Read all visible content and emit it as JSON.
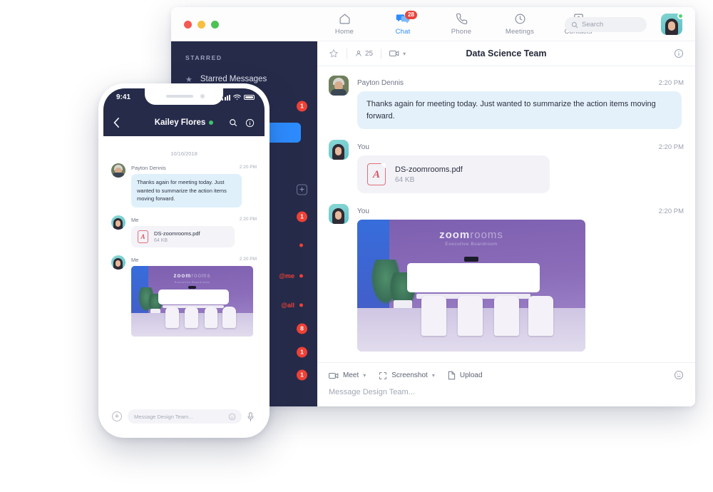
{
  "desktop": {
    "window_controls": [
      "close",
      "minimize",
      "maximize"
    ],
    "nav": [
      {
        "label": "Home",
        "icon": "home-icon",
        "active": false,
        "badge": ""
      },
      {
        "label": "Chat",
        "icon": "chat-icon",
        "active": true,
        "badge": "28"
      },
      {
        "label": "Phone",
        "icon": "phone-icon",
        "active": false,
        "badge": ""
      },
      {
        "label": "Meetings",
        "icon": "clock-icon",
        "active": false,
        "badge": ""
      },
      {
        "label": "Contacts",
        "icon": "contacts-icon",
        "active": false,
        "badge": ""
      }
    ],
    "search": {
      "placeholder": "Search",
      "icon": "search-icon"
    },
    "profile": {
      "name": "avatar",
      "presence": "available"
    },
    "sidebar": {
      "section_label": "STARRED",
      "items": [
        {
          "label": "Starred Messages",
          "icon": "star-icon",
          "badge": "",
          "dot": false,
          "mention": ""
        },
        {
          "label": "",
          "icon": "",
          "badge": "1",
          "dot": false,
          "mention": ""
        },
        {
          "label": "",
          "icon": "",
          "badge": "",
          "dot": false,
          "mention": "",
          "selected": true
        },
        {
          "label": "",
          "icon": "",
          "badge": "",
          "dot": false,
          "mention": ""
        },
        {
          "label": "",
          "icon": "",
          "badge": "",
          "dot": false,
          "mention": "",
          "plus": true
        },
        {
          "label": "",
          "icon": "",
          "badge": "1",
          "dot": false,
          "mention": ""
        },
        {
          "label": "",
          "icon": "",
          "badge": "",
          "dot": true,
          "mention": ""
        },
        {
          "label": "",
          "icon": "",
          "badge": "",
          "dot": true,
          "mention": "@me"
        },
        {
          "label": "",
          "icon": "",
          "badge": "",
          "dot": true,
          "mention": "@all"
        },
        {
          "label": "",
          "icon": "",
          "badge": "8",
          "dot": false,
          "mention": ""
        },
        {
          "label": "",
          "icon": "",
          "badge": "1",
          "dot": false,
          "mention": ""
        },
        {
          "label": "",
          "icon": "",
          "badge": "1",
          "dot": false,
          "mention": ""
        }
      ]
    },
    "chat_header": {
      "star_icon": "star-outline-icon",
      "members_count": "25",
      "members_icon": "person-icon",
      "camera_icon": "camera-icon",
      "title": "Data Science Team",
      "info_icon": "info-icon"
    },
    "messages": [
      {
        "sender": "Payton Dennis",
        "time": "2:20 PM",
        "type": "text",
        "text": "Thanks again for meeting today. Just wanted to summarize the action items moving forward.",
        "avatar": "payton"
      },
      {
        "sender": "You",
        "time": "2:20 PM",
        "type": "file",
        "file_name": "DS-zoomrooms.pdf",
        "file_size": "64 KB",
        "avatar": "me"
      },
      {
        "sender": "You",
        "time": "2:20 PM",
        "type": "image",
        "image_caption": "zoom",
        "image_caption_light": "rooms",
        "image_subtitle": "Executive Boardroom",
        "avatar": "me"
      }
    ],
    "composer": {
      "tools": [
        {
          "label": "Meet",
          "icon": "camera-icon",
          "has_caret": true
        },
        {
          "label": "Screenshot",
          "icon": "screenshot-icon",
          "has_caret": true
        },
        {
          "label": "Upload",
          "icon": "file-icon",
          "has_caret": false
        }
      ],
      "placeholder": "Message Design Team...",
      "emoji_icon": "emoji-icon"
    }
  },
  "phone": {
    "status_bar": {
      "time": "9:41",
      "signal_icon": "signal-icon",
      "wifi_icon": "wifi-icon",
      "battery_icon": "battery-icon"
    },
    "nav": {
      "back_icon": "back-chevron-icon",
      "title": "Kailey Flores",
      "presence": "online",
      "search_icon": "search-icon",
      "info_icon": "info-icon"
    },
    "date_divider": "10/16/2018",
    "messages": [
      {
        "sender": "Payton Dennis",
        "time": "2:20 PM",
        "type": "text",
        "text": "Thanks again for meeting today. Just wanted to summarize the action items moving forward.",
        "avatar": "payton"
      },
      {
        "sender": "Me",
        "time": "2:20 PM",
        "type": "file",
        "file_name": "DS-zoomrooms.pdf",
        "file_size": "64 KB",
        "avatar": "me"
      },
      {
        "sender": "Me",
        "time": "2:20 PM",
        "type": "image",
        "image_caption": "zoom",
        "image_caption_light": "rooms",
        "image_subtitle": "Executive Boardroom",
        "avatar": "me"
      }
    ],
    "composer": {
      "plus_icon": "plus-icon",
      "placeholder": "Message Design Team...",
      "emoji_icon": "emoji-icon",
      "mic_icon": "microphone-icon"
    }
  },
  "colors": {
    "accent_blue": "#2d8cff",
    "sidebar_dark": "#262b4a",
    "badge_red": "#ef4136",
    "bubble_blue": "#e4f1fb",
    "file_gray": "#f2f2f7",
    "online_green": "#3ec46d"
  }
}
